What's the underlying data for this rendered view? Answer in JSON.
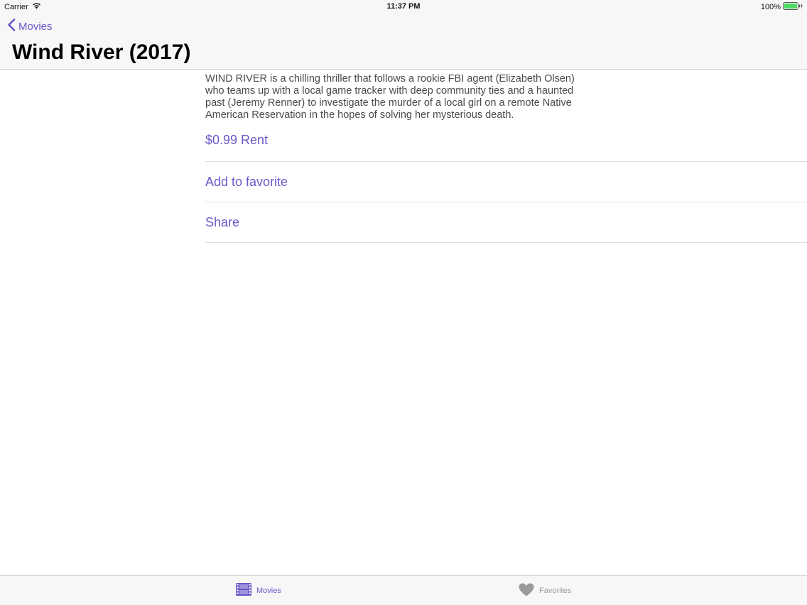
{
  "status_bar": {
    "carrier": "Carrier",
    "time": "11:37 PM",
    "battery": "100%"
  },
  "nav": {
    "back_label": "Movies",
    "title": "Wind River (2017)"
  },
  "movie": {
    "description": "WIND RIVER is a chilling thriller that follows a rookie FBI agent (Elizabeth Olsen) who teams up with a local game tracker with deep community ties and a haunted past (Jeremy Renner) to investigate the murder of a local girl on a remote Native American Reservation in the hopes of solving her mysterious death."
  },
  "actions": {
    "rent": "$0.99 Rent",
    "favorite": "Add to favorite",
    "share": "Share"
  },
  "tabs": {
    "movies": "Movies",
    "favorites": "Favorites"
  },
  "colors": {
    "accent": "#6b58c9",
    "inactive": "#9a9a9a",
    "battery": "#4cd964"
  }
}
